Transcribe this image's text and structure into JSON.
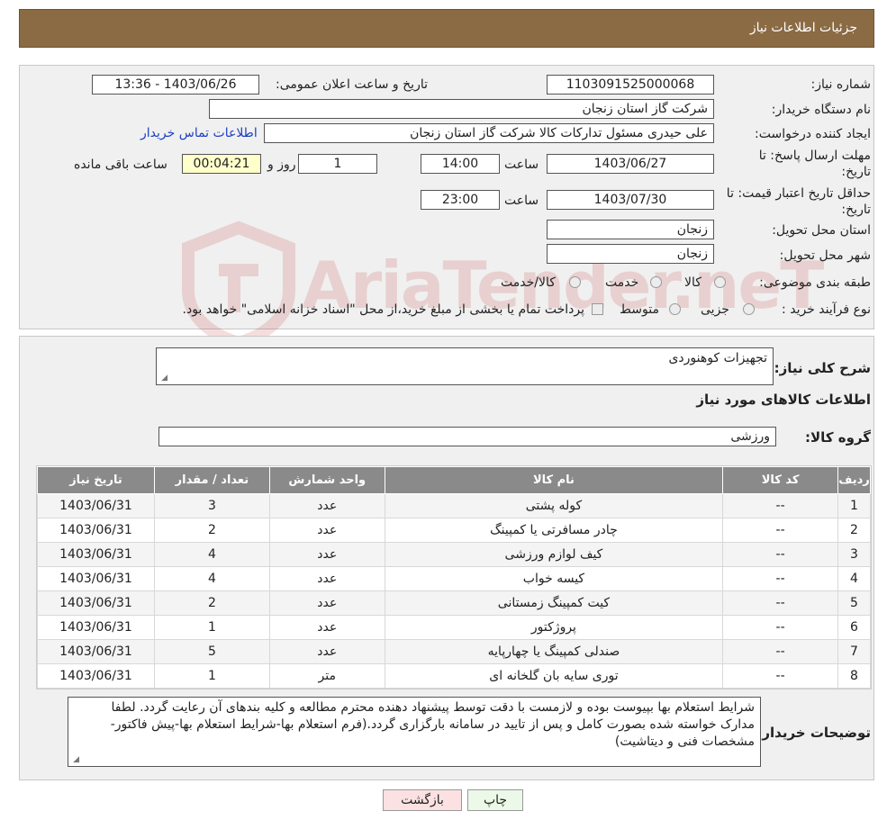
{
  "header": {
    "title": "جزئیات اطلاعات نیاز"
  },
  "watermark": {
    "text": "AriaTender.neT"
  },
  "info": {
    "need_number": {
      "label": "شماره نیاز:",
      "value": "1103091525000068"
    },
    "announce": {
      "label": "تاریخ و ساعت اعلان عمومی:",
      "value": "1403/06/26 - 13:36"
    },
    "buyer_org": {
      "label": "نام دستگاه خریدار:",
      "value": "شرکت گاز استان زنجان"
    },
    "requester": {
      "label": "ایجاد کننده درخواست:",
      "value": "علی حیدری مسئول تداركات كالا شرکت گاز استان زنجان",
      "contact_link": "اطلاعات تماس خریدار"
    },
    "deadline": {
      "label_line1": "مهلت ارسال پاسخ: تا",
      "label_line2": "تاریخ:",
      "date": "1403/06/27",
      "time_label": "ساعت",
      "time": "14:00",
      "days": "1",
      "days_label": "روز و",
      "remaining": "00:04:21",
      "remaining_label": "ساعت باقی مانده"
    },
    "validity": {
      "label_line1": "حداقل تاریخ اعتبار قیمت: تا",
      "label_line2": "تاریخ:",
      "date": "1403/07/30",
      "time_label": "ساعت",
      "time": "23:00"
    },
    "province": {
      "label": "استان محل تحویل:",
      "value": "زنجان"
    },
    "city": {
      "label": "شهر محل تحویل:",
      "value": "زنجان"
    },
    "category": {
      "label": "طبقه بندی موضوعی:",
      "options": [
        "کالا",
        "خدمت",
        "کالا/خدمت"
      ]
    },
    "process": {
      "label": "نوع فرآیند خرید :",
      "options": [
        "جزیی",
        "متوسط"
      ],
      "note": "پرداخت تمام یا بخشی از مبلغ خرید،از محل \"اسناد خزانه اسلامی\" خواهد بود."
    }
  },
  "details": {
    "summary_label": "شرح کلی نیاز:",
    "summary_value": "تجهیزات کوهنوردی",
    "items_title": "اطلاعات کالاهای مورد نیاز",
    "group_label": "گروه کالا:",
    "group_value": "ورزشی",
    "table": {
      "headers": [
        "ردیف",
        "کد کالا",
        "نام کالا",
        "واحد شمارش",
        "تعداد / مقدار",
        "تاریخ نیاز"
      ],
      "rows": [
        [
          "1",
          "--",
          "کوله پشتی",
          "عدد",
          "3",
          "1403/06/31"
        ],
        [
          "2",
          "--",
          "چادر مسافرتی یا کمپینگ",
          "عدد",
          "2",
          "1403/06/31"
        ],
        [
          "3",
          "--",
          "کیف لوازم ورزشی",
          "عدد",
          "4",
          "1403/06/31"
        ],
        [
          "4",
          "--",
          "کیسه خواب",
          "عدد",
          "4",
          "1403/06/31"
        ],
        [
          "5",
          "--",
          "کیت کمپینگ زمستانی",
          "عدد",
          "2",
          "1403/06/31"
        ],
        [
          "6",
          "--",
          "پروژکتور",
          "عدد",
          "1",
          "1403/06/31"
        ],
        [
          "7",
          "--",
          "صندلی کمپینگ یا چهارپایه",
          "عدد",
          "5",
          "1403/06/31"
        ],
        [
          "8",
          "--",
          "توری سایه بان گلخانه ای",
          "متر",
          "1",
          "1403/06/31"
        ]
      ]
    },
    "buyer_notes_label": "توضیحات خریدار:",
    "buyer_notes": "شرایط استعلام بها بپیوست بوده و لازمست با دقت توسط پیشنهاد دهنده محترم مطالعه و کلیه بندهای آن رعایت گردد. لطفا مدارک خواسته شده بصورت کامل و پس از تایید در سامانه بارگزاری گردد.(فرم استعلام بها-شرایط استعلام بها-پیش فاکتور-مشخصات فنی و دیتاشیت)"
  },
  "buttons": {
    "print": "چاپ",
    "back": "بازگشت"
  }
}
